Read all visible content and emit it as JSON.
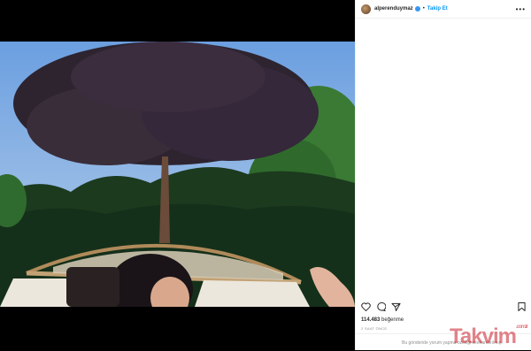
{
  "post": {
    "username": "alperenduymaz",
    "follow_label": "Takip Et",
    "more_label": "•••",
    "likes_count": "114.483",
    "likes_suffix": "beğenme",
    "time_ago": "2 SAAT ÖNCE",
    "comments_disabled": "Bu gönderide yorum yapma özelliği sınırlandırılmış."
  },
  "watermark": {
    "text": "Takvim",
    "suffix": ".com.tr"
  },
  "colors": {
    "link": "#0095f6",
    "verified": "#3897f0",
    "sky": "#79a9e0"
  },
  "icons": [
    "heart-icon",
    "comment-icon",
    "share-icon",
    "bookmark-icon",
    "more-icon",
    "verified-icon"
  ]
}
